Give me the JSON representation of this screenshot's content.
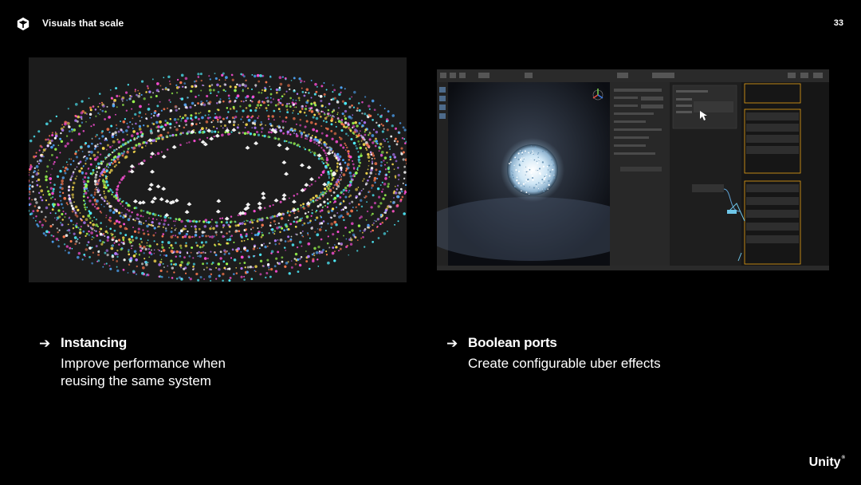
{
  "header": {
    "title": "Visuals that scale",
    "page_number": "33",
    "logo_icon": "unity-cube-icon"
  },
  "media": {
    "left": {
      "description_icon": "particle-rings-image"
    },
    "right": {
      "description_icon": "vfx-graph-editor-image"
    }
  },
  "features": [
    {
      "arrow": "➔",
      "title": "Instancing",
      "description_lines": [
        "Improve performance when",
        "reusing the same system"
      ]
    },
    {
      "arrow": "➔",
      "title": "Boolean ports",
      "description_lines": [
        "Create configurable uber effects"
      ]
    }
  ],
  "footer": {
    "brand": "Unity"
  },
  "colors": {
    "background": "#000000",
    "text": "#ffffff",
    "panel": "#1c1c1c",
    "accent_orange": "#e8a317"
  }
}
